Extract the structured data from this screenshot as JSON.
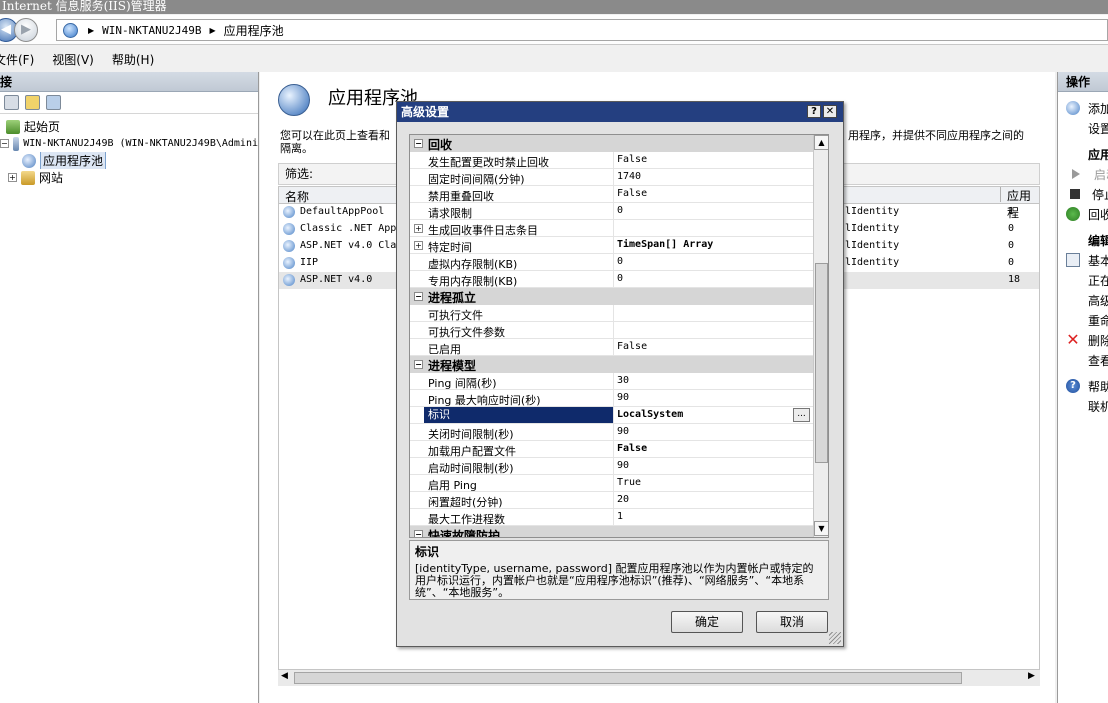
{
  "window": {
    "title": "Internet 信息服务(IIS)管理器"
  },
  "address": {
    "segments": [
      "WIN-NKTANU2J49B",
      "应用程序池"
    ]
  },
  "menu": [
    "文件(F)",
    "视图(V)",
    "帮助(H)"
  ],
  "connections": {
    "header": "接",
    "tree": [
      {
        "label": "起始页",
        "icon": "home-icon"
      },
      {
        "label": "WIN-NKTANU2J49B (WIN-NKTANU2J49B\\Admini",
        "icon": "server-icon",
        "expander": "−"
      },
      {
        "label": "应用程序池",
        "icon": "app-pool-icon",
        "selected": true
      },
      {
        "label": "网站",
        "icon": "sites-icon",
        "expander": "+"
      }
    ]
  },
  "center": {
    "title": "应用程序池",
    "description_left": "您可以在此页上查看和",
    "description_left2": "隔离。",
    "description_right": "用程序，并提供不同应用程序之间的",
    "filter_label": "筛选:",
    "columns": {
      "name": "名称",
      "apps": "应用程"
    },
    "rows": [
      {
        "name": "DefaultAppPool",
        "identity": "lIdentity",
        "apps": "1"
      },
      {
        "name": "Classic .NET App",
        "identity": "lIdentity",
        "apps": "0"
      },
      {
        "name": "ASP.NET v4.0 Cla",
        "identity": "lIdentity",
        "apps": "0"
      },
      {
        "name": "IIP",
        "identity": "lIdentity",
        "apps": "0"
      },
      {
        "name": "ASP.NET v4.0",
        "identity": "",
        "apps": "18",
        "selected": true
      }
    ]
  },
  "actions": {
    "header": "操作",
    "items": [
      {
        "label": "添加",
        "icon": "add-pool-icon"
      },
      {
        "label": "设置",
        "kind": "sub"
      },
      {
        "label": "应用",
        "kind": "bold"
      },
      {
        "label": "启动",
        "icon": "start-icon",
        "disabled": true
      },
      {
        "label": "停止",
        "icon": "stop-icon"
      },
      {
        "label": "回收",
        "icon": "recycle-icon"
      },
      {
        "label": "编辑",
        "kind": "bold"
      },
      {
        "label": "基本",
        "icon": "basic-settings-icon"
      },
      {
        "label": "正在",
        "kind": "sub"
      },
      {
        "label": "高级",
        "kind": "sub"
      },
      {
        "label": "重命",
        "kind": "sub"
      },
      {
        "label": "删除",
        "icon": "delete-icon"
      },
      {
        "label": "查看",
        "kind": "sub"
      },
      {
        "label": "帮助",
        "icon": "help-icon"
      },
      {
        "label": "联机",
        "kind": "sub"
      }
    ]
  },
  "dialog": {
    "title": "高级设置",
    "help_btn": "?",
    "close_btn": "✕",
    "properties": [
      {
        "type": "cat",
        "name": "回收",
        "exp": "⊟"
      },
      {
        "name": "发生配置更改时禁止回收",
        "value": "False"
      },
      {
        "name": "固定时间间隔(分钟)",
        "value": "1740"
      },
      {
        "name": "禁用重叠回收",
        "value": "False"
      },
      {
        "name": "请求限制",
        "value": "0"
      },
      {
        "name": "生成回收事件日志条目",
        "value": "",
        "exp": "⊞"
      },
      {
        "name": "特定时间",
        "value": "TimeSpan[] Array",
        "exp": "⊞",
        "bold": true
      },
      {
        "name": "虚拟内存限制(KB)",
        "value": "0"
      },
      {
        "name": "专用内存限制(KB)",
        "value": "0"
      },
      {
        "type": "cat",
        "name": "进程孤立",
        "exp": "⊟"
      },
      {
        "name": "可执行文件",
        "value": ""
      },
      {
        "name": "可执行文件参数",
        "value": ""
      },
      {
        "name": "已启用",
        "value": "False"
      },
      {
        "type": "cat",
        "name": "进程模型",
        "exp": "⊟"
      },
      {
        "name": "Ping 间隔(秒)",
        "value": "30"
      },
      {
        "name": "Ping 最大响应时间(秒)",
        "value": "90"
      },
      {
        "name": "标识",
        "value": "LocalSystem",
        "bold": true,
        "selected": true,
        "ellipsis": "..."
      },
      {
        "name": "关闭时间限制(秒)",
        "value": "90"
      },
      {
        "name": "加载用户配置文件",
        "value": "False",
        "bold": true
      },
      {
        "name": "启动时间限制(秒)",
        "value": "90"
      },
      {
        "name": "启用 Ping",
        "value": "True"
      },
      {
        "name": "闲置超时(分钟)",
        "value": "20"
      },
      {
        "name": "最大工作进程数",
        "value": "1"
      },
      {
        "type": "cat",
        "name": "快速故障防护",
        "exp": "⊟"
      }
    ],
    "description_title": "标识",
    "description_text": "[identityType, username, password] 配置应用程序池以作为内置帐户或特定的用户标识运行，内置帐户也就是“应用程序池标识”(推荐)、“网络服务”、“本地系统”、“本地服务”。",
    "ok": "确定",
    "cancel": "取消"
  }
}
